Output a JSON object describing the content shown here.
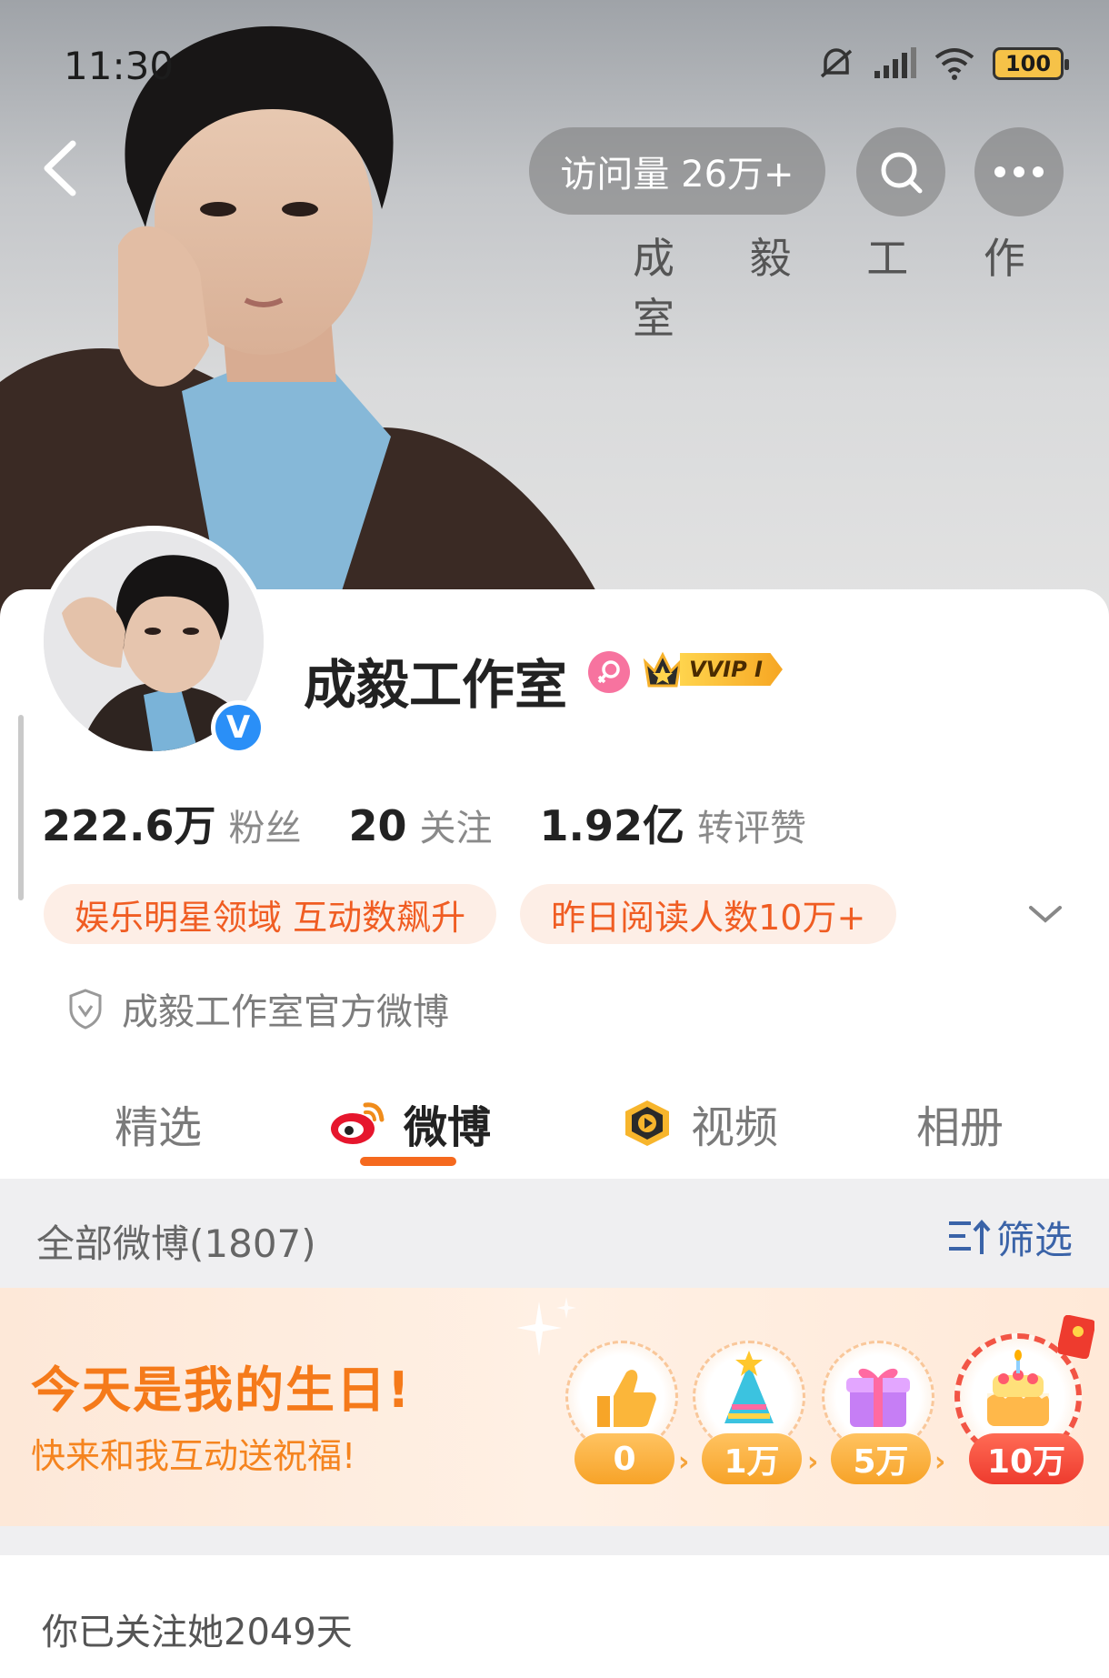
{
  "status_bar": {
    "time": "11:30",
    "battery": "100"
  },
  "header": {
    "visits_label": "访问量 26万+",
    "hero_caption": "成 毅 工 作 室",
    "icons": [
      "back-icon",
      "search-icon",
      "more-icon"
    ]
  },
  "profile": {
    "name": "成毅工作室",
    "vip_label": "VVIP I",
    "stats": [
      {
        "value": "222.6万",
        "label": "粉丝"
      },
      {
        "value": "20",
        "label": "关注"
      },
      {
        "value": "1.92亿",
        "label": "转评赞"
      }
    ],
    "tags": [
      "娱乐明星领域 互动数飙升",
      "昨日阅读人数10万+"
    ],
    "official_desc": "成毅工作室官方微博"
  },
  "tabs": [
    {
      "label": "精选",
      "active": false
    },
    {
      "label": "微博",
      "active": true
    },
    {
      "label": "视频",
      "active": false
    },
    {
      "label": "相册",
      "active": false
    }
  ],
  "feed": {
    "all_posts": "全部微博(1807)",
    "filter_label": "筛选"
  },
  "birthday": {
    "title": "今天是我的生日!",
    "subtitle": "快来和我互动送祝福!",
    "milestones": [
      "0",
      "1万",
      "5万",
      "10万"
    ]
  },
  "follow_days": "你已关注她2049天",
  "colors": {
    "accent": "#f5691e",
    "tag_bg": "#fdeee6",
    "tag_text": "#f05d23",
    "verified_blue": "#2a8ff7",
    "filter_blue": "#3a63a8"
  }
}
